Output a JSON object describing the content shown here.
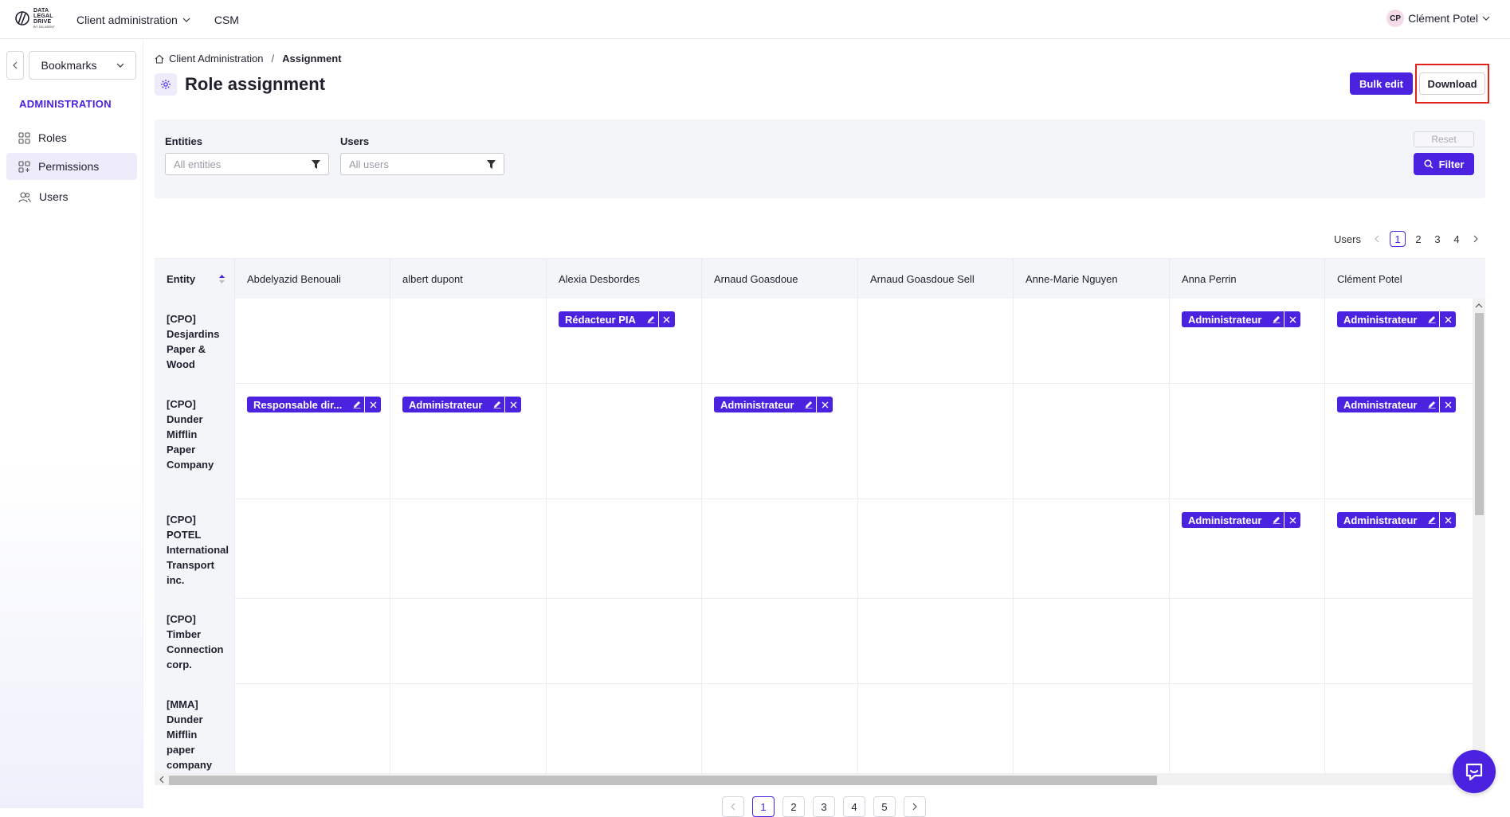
{
  "colors": {
    "accent": "#4a22e0",
    "highlight": "#e2231a"
  },
  "header": {
    "logo_lines": [
      "DATA",
      "LEGAL",
      "DRIVE"
    ],
    "logo_sub": "BY DILIGENT",
    "nav": [
      {
        "label": "Client administration",
        "icon": "chevron-down-icon"
      },
      {
        "label": "CSM"
      }
    ],
    "user_initials": "CP",
    "user_name": "Clément Potel"
  },
  "sidebar": {
    "bookmarks_label": "Bookmarks",
    "section_title": "ADMINISTRATION",
    "items": [
      {
        "label": "Roles",
        "icon": "grid-icon",
        "active": false
      },
      {
        "label": "Permissions",
        "icon": "grid-plus-icon",
        "active": true
      },
      {
        "label": "Users",
        "icon": "users-icon",
        "active": false
      }
    ]
  },
  "breadcrumb": {
    "home": "Client Administration",
    "separator": "/",
    "current": "Assignment"
  },
  "page": {
    "title": "Role assignment",
    "icon": "gear-icon"
  },
  "actions": {
    "bulk_edit": "Bulk edit",
    "download": "Download"
  },
  "filters": {
    "entities_label": "Entities",
    "entities_placeholder": "All entities",
    "users_label": "Users",
    "users_placeholder": "All users",
    "reset": "Reset",
    "filter": "Filter"
  },
  "users_pager": {
    "label": "Users",
    "pages": [
      "1",
      "2",
      "3",
      "4"
    ],
    "current": "1"
  },
  "table": {
    "entity_header": "Entity",
    "columns": [
      "Abdelyazid Benouali",
      "albert dupont",
      "Alexia Desbordes",
      "Arnaud Goasdoue",
      "Arnaud Goasdoue Sell",
      "Anne-Marie Nguyen",
      "Anna Perrin",
      "Clément Potel"
    ],
    "rows": [
      {
        "entity": "[CPO] Desjardins Paper & Wood",
        "roles": [
          "",
          "",
          "Rédacteur PIA",
          "",
          "",
          "",
          "Administrateur",
          "Administrateur"
        ]
      },
      {
        "entity": "[CPO] Dunder Mifflin Paper Company",
        "roles": [
          "Responsable dir...",
          "Administrateur",
          "",
          "Administrateur",
          "",
          "",
          "",
          "Administrateur"
        ]
      },
      {
        "entity": "[CPO] POTEL International Transport inc.",
        "roles": [
          "",
          "",
          "",
          "",
          "",
          "",
          "Administrateur",
          "Administrateur"
        ]
      },
      {
        "entity": "[CPO] Timber Connection corp.",
        "roles": [
          "",
          "",
          "",
          "",
          "",
          "",
          "",
          ""
        ]
      },
      {
        "entity": "[MMA] Dunder Mifflin paper company (entité fille)",
        "roles": [
          "",
          "",
          "",
          "",
          "",
          "",
          "",
          ""
        ]
      }
    ]
  },
  "bottom_pager": {
    "pages": [
      "1",
      "2",
      "3",
      "4",
      "5"
    ],
    "current": "1"
  }
}
